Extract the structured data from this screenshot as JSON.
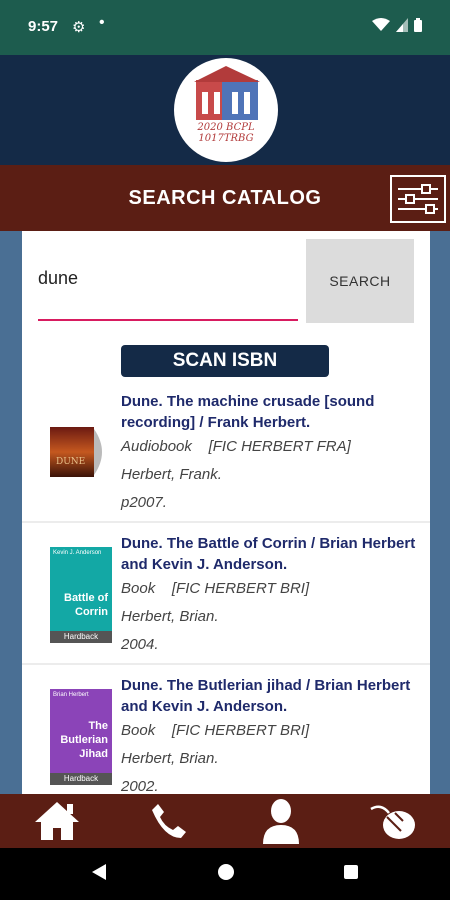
{
  "status": {
    "time": "9:57",
    "gear": "⚙",
    "dot": "•"
  },
  "header": {
    "logo_line1": "2020 BCPL",
    "logo_line2": "1017TRBG"
  },
  "title_bar": {
    "title": "SEARCH CATALOG"
  },
  "search": {
    "value": "dune",
    "button_label": "SEARCH"
  },
  "scan": {
    "label": "SCAN ISBN"
  },
  "results": [
    {
      "title": "Dune. The machine crusade [sound recording] / Frank Herbert.",
      "format": "Audiobook",
      "callno": "[FIC HERBERT FRA]",
      "author": "Herbert, Frank.",
      "date": "p2007.",
      "cover_text": "DUNE"
    },
    {
      "title": "Dune. The Battle of Corrin / Brian Herbert and Kevin J. Anderson.",
      "format": "Book",
      "callno": "[FIC HERBERT BRI]",
      "author": "Herbert, Brian.",
      "date": "2004.",
      "cover_author": "Kevin J. Anderson",
      "cover_title": "Battle of Corrin",
      "cover_label": "Hardback"
    },
    {
      "title": "Dune. The Butlerian jihad / Brian Herbert and Kevin J. Anderson.",
      "format": "Book",
      "callno": "[FIC HERBERT BRI]",
      "author": "Herbert, Brian.",
      "date": "2002.",
      "cover_author": "Brian Herbert",
      "cover_title": "The Butlerian Jihad",
      "cover_label": "Hardback"
    }
  ],
  "nav": {
    "items": [
      "home-icon",
      "phone-icon",
      "user-icon",
      "mouse-icon"
    ]
  },
  "colors": {
    "accent": "#d81b60",
    "navy": "#142a47",
    "maroon": "#5b1e14",
    "status_green": "#1d5c4e"
  }
}
